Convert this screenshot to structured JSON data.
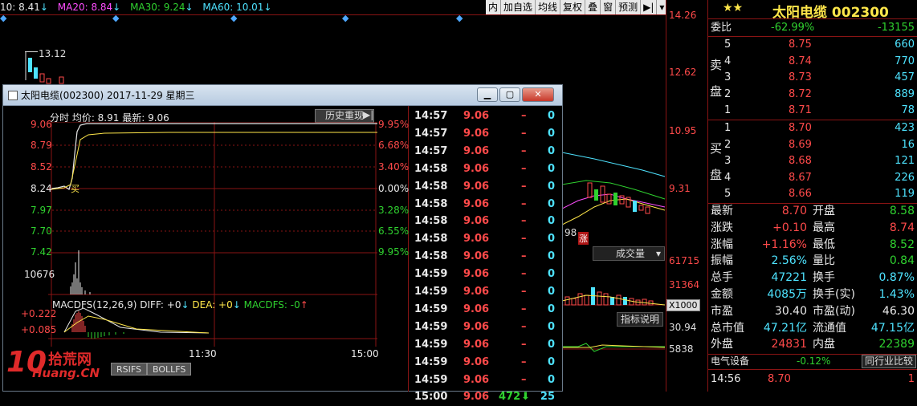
{
  "ma_bar": {
    "ma10": "10: 8.41",
    "ma20": "MA20: 8.84",
    "ma30": "MA30: 9.24",
    "ma60": "MA60: 10.01",
    "arrow_down": "↓"
  },
  "toolbar": [
    "内",
    "加自选",
    "均线",
    "复权",
    "叠",
    "窗",
    "预测"
  ],
  "main_chart": {
    "price_axis": [
      "14.26",
      "12.62",
      "10.95",
      "9.31"
    ],
    "high_label": "13.12",
    "volume_dropdown": "成交量",
    "volume_axis": [
      "61715",
      "31364",
      "X1000"
    ],
    "indicator_btn": "指标说明",
    "ind_axis": [
      "30.94",
      "5838"
    ],
    "zhang_label": "涨",
    "partial_text": "98"
  },
  "popup": {
    "title": "太阳电缆(002300) 2017-11-29 星期三",
    "header": "分时 均价: 8.91 最新: 9.06",
    "history_btn": "历史重现",
    "price_scale": [
      "9.06",
      "8.79",
      "8.52",
      "8.24",
      "7.97",
      "7.70",
      "7.42"
    ],
    "pct_scale": [
      "9.95%",
      "6.68%",
      "3.40%",
      "0.00%",
      "3.28%",
      "6.55%",
      "9.95%"
    ],
    "volume_max": "10676",
    "buy_mark": "买",
    "macd_header": {
      "name": "MACDFS(12,26,9)",
      "diff": "DIFF: +0",
      "dea": "DEA: +0",
      "macdfs": "MACDFS: -0"
    },
    "macd_scale": [
      "+0.222",
      "+0.085"
    ],
    "time_labels": [
      "11:30",
      "15:00"
    ],
    "tabs": [
      "RSIFS",
      "BOLLFS"
    ],
    "ticks": [
      {
        "time": "14:57",
        "price": "9.06",
        "vol": "–",
        "n": "0"
      },
      {
        "time": "14:57",
        "price": "9.06",
        "vol": "–",
        "n": "0"
      },
      {
        "time": "14:57",
        "price": "9.06",
        "vol": "–",
        "n": "0"
      },
      {
        "time": "14:58",
        "price": "9.06",
        "vol": "–",
        "n": "0"
      },
      {
        "time": "14:58",
        "price": "9.06",
        "vol": "–",
        "n": "0"
      },
      {
        "time": "14:58",
        "price": "9.06",
        "vol": "–",
        "n": "0"
      },
      {
        "time": "14:58",
        "price": "9.06",
        "vol": "–",
        "n": "0"
      },
      {
        "time": "14:58",
        "price": "9.06",
        "vol": "–",
        "n": "0"
      },
      {
        "time": "14:58",
        "price": "9.06",
        "vol": "–",
        "n": "0"
      },
      {
        "time": "14:59",
        "price": "9.06",
        "vol": "–",
        "n": "0"
      },
      {
        "time": "14:59",
        "price": "9.06",
        "vol": "–",
        "n": "0"
      },
      {
        "time": "14:59",
        "price": "9.06",
        "vol": "–",
        "n": "0"
      },
      {
        "time": "14:59",
        "price": "9.06",
        "vol": "–",
        "n": "0"
      },
      {
        "time": "14:59",
        "price": "9.06",
        "vol": "–",
        "n": "0"
      },
      {
        "time": "14:59",
        "price": "9.06",
        "vol": "–",
        "n": "0"
      },
      {
        "time": "14:59",
        "price": "9.06",
        "vol": "–",
        "n": "0"
      },
      {
        "time": "15:00",
        "price": "9.06",
        "vol": "472",
        "n": "25"
      }
    ],
    "tick_arrow": "⬇"
  },
  "right_panel": {
    "stars": "★★",
    "stock_name": "太阳电缆 002300",
    "weibi": {
      "label": "委比",
      "pct": "-62.99%",
      "diff": "-13155"
    },
    "sell_label": [
      "卖",
      "盘"
    ],
    "buy_label": [
      "买",
      "盘"
    ],
    "sell": [
      {
        "lvl": "5",
        "price": "8.75",
        "vol": "660"
      },
      {
        "lvl": "4",
        "price": "8.74",
        "vol": "770"
      },
      {
        "lvl": "3",
        "price": "8.73",
        "vol": "457"
      },
      {
        "lvl": "2",
        "price": "8.72",
        "vol": "889"
      },
      {
        "lvl": "1",
        "price": "8.71",
        "vol": "78"
      }
    ],
    "buy": [
      {
        "lvl": "1",
        "price": "8.70",
        "vol": "423"
      },
      {
        "lvl": "2",
        "price": "8.69",
        "vol": "16"
      },
      {
        "lvl": "3",
        "price": "8.68",
        "vol": "121"
      },
      {
        "lvl": "4",
        "price": "8.67",
        "vol": "226"
      },
      {
        "lvl": "5",
        "price": "8.66",
        "vol": "119"
      }
    ],
    "stats": [
      {
        "l1": "最新",
        "v1": "8.70",
        "c1": "red",
        "l2": "开盘",
        "v2": "8.58",
        "c2": "green"
      },
      {
        "l1": "涨跌",
        "v1": "+0.10",
        "c1": "red",
        "l2": "最高",
        "v2": "8.74",
        "c2": "red"
      },
      {
        "l1": "涨幅",
        "v1": "+1.16%",
        "c1": "red",
        "l2": "最低",
        "v2": "8.52",
        "c2": "green"
      },
      {
        "l1": "振幅",
        "v1": "2.56%",
        "c1": "cyan",
        "l2": "量比",
        "v2": "0.84",
        "c2": "green"
      },
      {
        "l1": "总手",
        "v1": "47221",
        "c1": "cyan",
        "l2": "换手",
        "v2": "0.87%",
        "c2": "cyan"
      },
      {
        "l1": "金额",
        "v1": "4085万",
        "c1": "cyan",
        "l2": "换手(实)",
        "v2": "1.43%",
        "c2": "cyan"
      },
      {
        "l1": "市盈",
        "v1": "30.40",
        "c1": "white",
        "l2": "市盈(动)",
        "v2": "46.30",
        "c2": "white"
      },
      {
        "l1": "总市值",
        "v1": "47.21亿",
        "c1": "cyan",
        "l2": "流通值",
        "v2": "47.15亿",
        "c2": "cyan"
      },
      {
        "l1": "外盘",
        "v1": "24831",
        "c1": "red",
        "l2": "内盘",
        "v2": "22389",
        "c2": "green"
      }
    ],
    "sector": {
      "name": "电气设备",
      "pct": "-0.12%",
      "btn": "同行业比较"
    },
    "last_tick": {
      "time": "14:56",
      "price": "8.70",
      "vol": "1"
    }
  },
  "watermark": {
    "number": "10",
    "cn": "拾荒网",
    "url": "Huang.CN"
  },
  "colors": {
    "up": "#ff4a4a",
    "down": "#2fd12f",
    "grid": "#8a1414",
    "accent": "#4ee3ff"
  }
}
